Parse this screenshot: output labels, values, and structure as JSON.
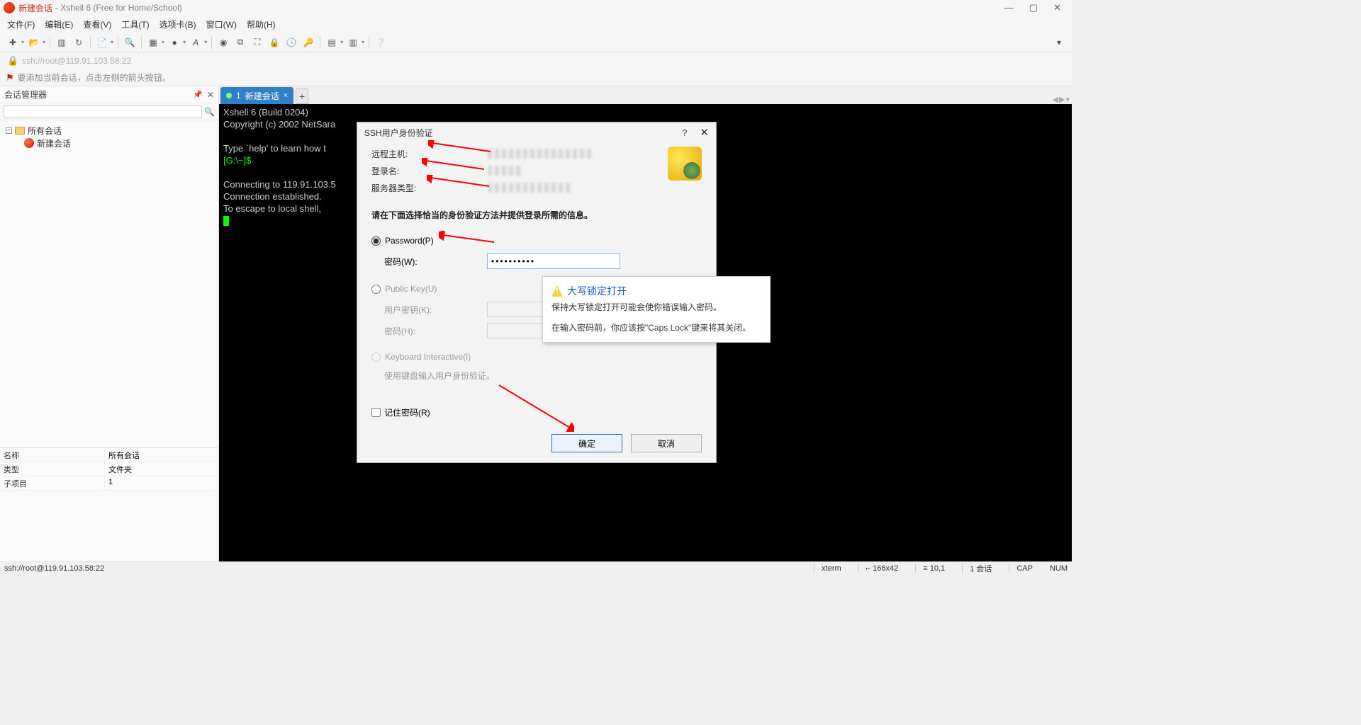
{
  "titlebar": {
    "session_name": "新建会话",
    "app_title": "- Xshell 6 (Free for Home/School)"
  },
  "menu": [
    "文件(F)",
    "编辑(E)",
    "查看(V)",
    "工具(T)",
    "选项卡(B)",
    "窗口(W)",
    "帮助(H)"
  ],
  "address": "ssh://root@119.91.103.58:22",
  "info_strip": "要添加当前会话，点击左侧的箭头按钮。",
  "sidebar": {
    "title": "会话管理器",
    "tree_root": "所有会话",
    "tree_child": "新建会话",
    "props": [
      {
        "k": "名称",
        "v": "所有会话"
      },
      {
        "k": "类型",
        "v": "文件夹"
      },
      {
        "k": "子项目",
        "v": "1"
      }
    ]
  },
  "tab": {
    "index": "1",
    "label": "新建会话"
  },
  "terminal": {
    "l1": "Xshell 6 (Build 0204)",
    "l2": "Copyright (c) 2002 NetSara",
    "l3": "Type `help' to learn how t",
    "l4": "[G:\\~]$",
    "l5": "Connecting to 119.91.103.5",
    "l6": "Connection established.",
    "l7": "To escape to local shell, "
  },
  "dialog": {
    "title": "SSH用户身份验证",
    "remote_host_label": "远程主机:",
    "login_label": "登录名:",
    "server_type_label": "服务器类型:",
    "instruction": "请在下面选择恰当的身份验证方法并提供登录所需的信息。",
    "opt_password": "Password(P)",
    "password_label": "密码(W):",
    "password_value": "●●●●●●●●●●",
    "opt_publickey": "Public Key(U)",
    "userkey_label": "用户密钥(K):",
    "passphrase_label": "密码(H):",
    "opt_kbd": "Keyboard Interactive(I)",
    "kbd_desc": "使用键盘输入用户身份验证。",
    "remember": "记住密码(R)",
    "ok": "确定",
    "cancel": "取消"
  },
  "tooltip": {
    "title": "大写锁定打开",
    "line1": "保持大写锁定打开可能会使你错误输入密码。",
    "line2": "在输入密码前，你应该按\"Caps Lock\"键来将其关闭。"
  },
  "statusbar": {
    "left": "ssh://root@119.91.103.58:22",
    "term": "xterm",
    "size": "166x42",
    "rc": "10,1",
    "sess": "1 会话",
    "cap": "CAP",
    "num": "NUM"
  }
}
